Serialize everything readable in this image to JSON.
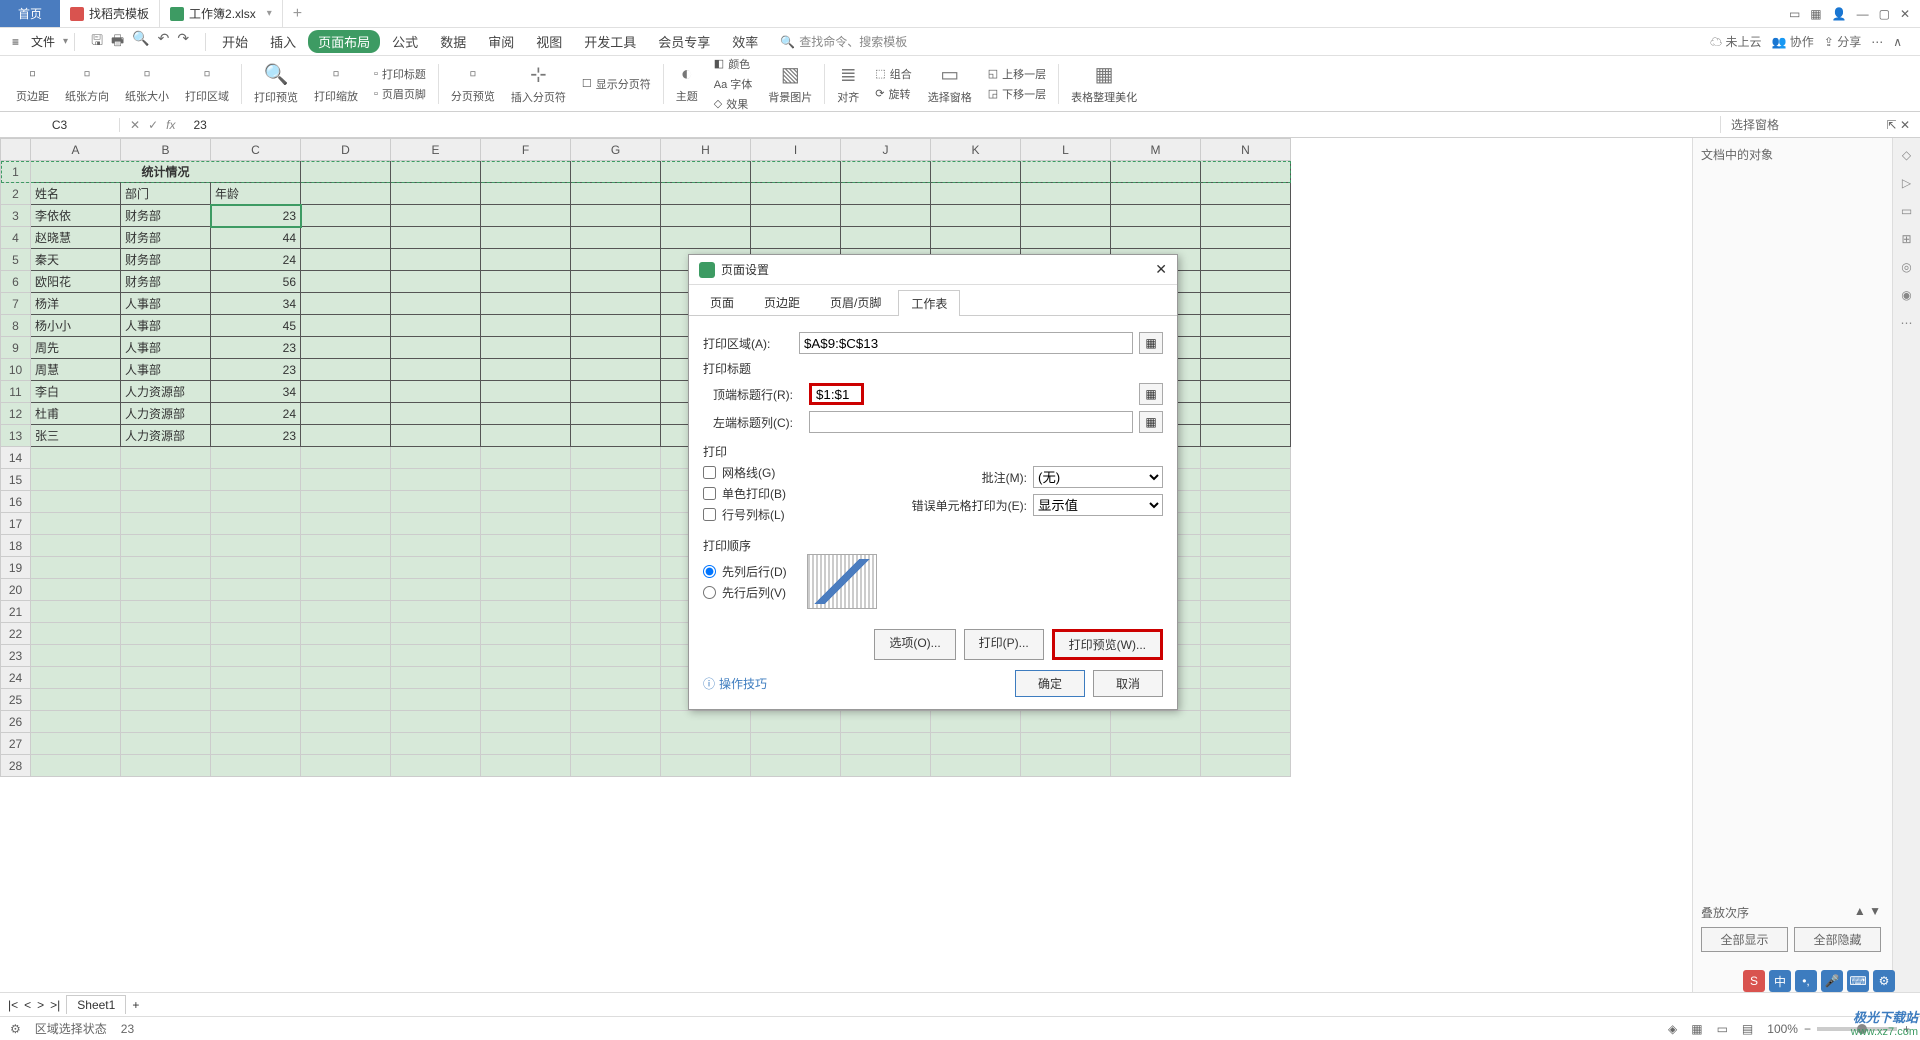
{
  "titlebar": {
    "home": "首页",
    "tab_template": "找稻壳模板",
    "tab_workbook": "工作簿2.xlsx",
    "add": "+"
  },
  "menubar": {
    "file": "文件",
    "tabs": [
      "开始",
      "插入",
      "页面布局",
      "公式",
      "数据",
      "审阅",
      "视图",
      "开发工具",
      "会员专享",
      "效率"
    ],
    "active_index": 2,
    "search_hint": "查找命令、搜索模板",
    "cloud": "未上云",
    "coop": "协作",
    "share": "分享"
  },
  "ribbon": {
    "groups": [
      {
        "label": "页边距",
        "icon": "▭"
      },
      {
        "label": "纸张方向",
        "icon": "▭"
      },
      {
        "label": "纸张大小",
        "icon": "▭"
      },
      {
        "label": "打印区域",
        "icon": "▭"
      },
      {
        "label": "打印预览",
        "icon": "🔍"
      },
      {
        "label": "打印缩放",
        "icon": "▭"
      }
    ],
    "small1": [
      {
        "label": "打印标题",
        "icon": "▭"
      },
      {
        "label": "页眉页脚",
        "icon": "▭"
      }
    ],
    "groups2": [
      {
        "label": "分页预览",
        "icon": "▭"
      },
      {
        "label": "插入分页符",
        "icon": "▭"
      }
    ],
    "small2": [
      {
        "label": "显示分页符",
        "icon": "☐"
      }
    ],
    "groups3": [
      {
        "label": "主题",
        "icon": "◐"
      }
    ],
    "small3": [
      {
        "label": "颜色",
        "icon": "◧"
      },
      {
        "label": "Aa 字体",
        "icon": "Aa"
      },
      {
        "label": "效果",
        "icon": "◇"
      }
    ],
    "groups4": [
      {
        "label": "背景图片",
        "icon": "▧"
      },
      {
        "label": "对齐",
        "icon": "≣"
      }
    ],
    "small4": [
      {
        "label": "组合",
        "icon": "⬚"
      },
      {
        "label": "旋转",
        "icon": "⟳"
      }
    ],
    "groups5": [
      {
        "label": "选择窗格",
        "icon": "▭"
      }
    ],
    "small5": [
      {
        "label": "上移一层",
        "icon": "◱"
      },
      {
        "label": "下移一层",
        "icon": "◲"
      }
    ],
    "groups6": [
      {
        "label": "表格整理美化",
        "icon": "▦"
      }
    ]
  },
  "namebox": "C3",
  "formula": "23",
  "rightpane": {
    "title": "选择窗格",
    "body": "文档中的对象"
  },
  "columns": [
    "A",
    "B",
    "C",
    "D",
    "E",
    "F",
    "G",
    "H",
    "I",
    "J",
    "K",
    "L",
    "M",
    "N"
  ],
  "sheet": {
    "title": "统计情况",
    "headers": [
      "姓名",
      "部门",
      "年龄"
    ],
    "rows": [
      [
        "李依依",
        "财务部",
        "23"
      ],
      [
        "赵晓慧",
        "财务部",
        "44"
      ],
      [
        "秦天",
        "财务部",
        "24"
      ],
      [
        "欧阳花",
        "财务部",
        "56"
      ],
      [
        "杨洋",
        "人事部",
        "34"
      ],
      [
        "杨小小",
        "人事部",
        "45"
      ],
      [
        "周先",
        "人事部",
        "23"
      ],
      [
        "周慧",
        "人事部",
        "23"
      ],
      [
        "李白",
        "人力资源部",
        "34"
      ],
      [
        "杜甫",
        "人力资源部",
        "24"
      ],
      [
        "张三",
        "人力资源部",
        "23"
      ]
    ]
  },
  "dialog": {
    "title": "页面设置",
    "tabs": [
      "页面",
      "页边距",
      "页眉/页脚",
      "工作表"
    ],
    "active_tab": 3,
    "print_area_label": "打印区域(A):",
    "print_area_value": "$A$9:$C$13",
    "print_titles": "打印标题",
    "top_row_label": "顶端标题行(R):",
    "top_row_value": "$1:$1",
    "left_col_label": "左端标题列(C):",
    "left_col_value": "",
    "print_section": "打印",
    "gridlines": "网格线(G)",
    "bw": "单色打印(B)",
    "rowcol": "行号列标(L)",
    "comments_label": "批注(M):",
    "comments_value": "(无)",
    "errors_label": "错误单元格打印为(E):",
    "errors_value": "显示值",
    "order_section": "打印顺序",
    "order1": "先列后行(D)",
    "order2": "先行后列(V)",
    "btn_options": "选项(O)...",
    "btn_print": "打印(P)...",
    "btn_preview": "打印预览(W)...",
    "btn_ok": "确定",
    "btn_cancel": "取消",
    "hint": "操作技巧"
  },
  "sheet_tabs": {
    "nav": [
      "|<",
      "<",
      ">",
      ">|"
    ],
    "name": "Sheet1",
    "add": "+"
  },
  "statusbar": {
    "mode": "区域选择状态",
    "val": "23",
    "zoom": "100%"
  },
  "bottom_pane": {
    "label": "叠放次序",
    "show_all": "全部显示",
    "hide_all": "全部隐藏"
  },
  "watermark": {
    "line1": "极光下载站",
    "line2": "www.xz7.com"
  }
}
